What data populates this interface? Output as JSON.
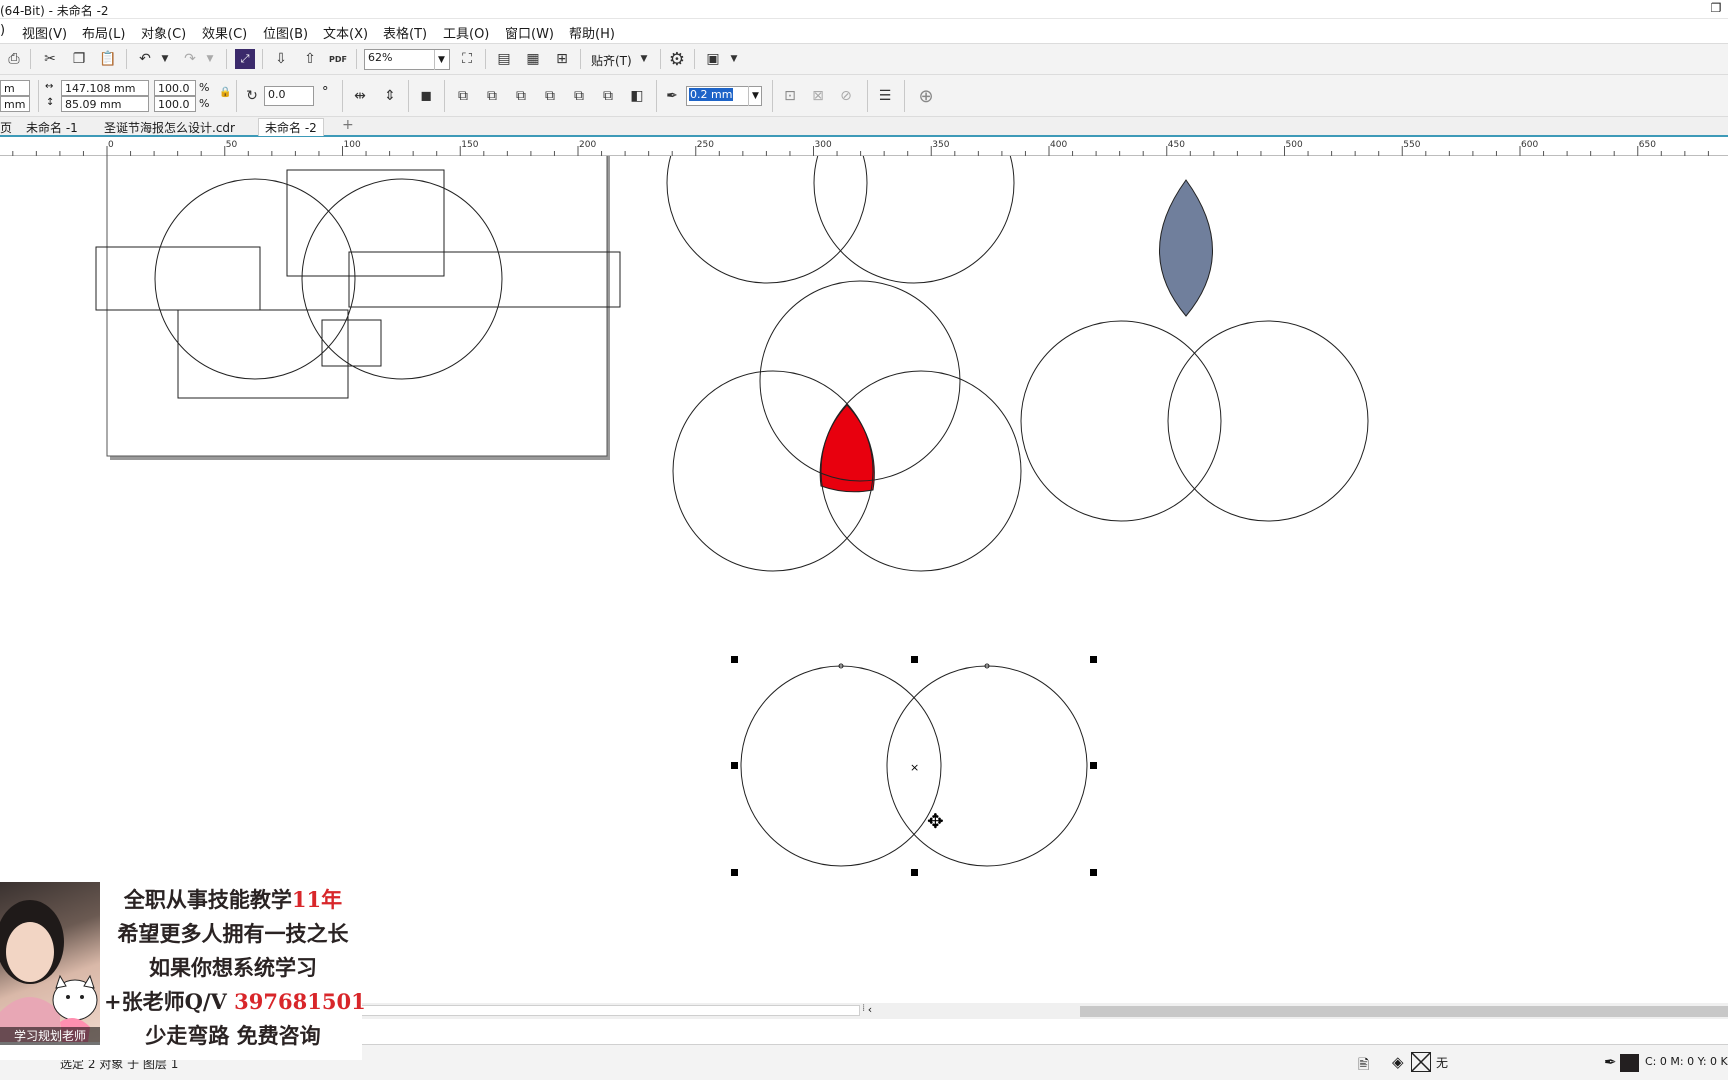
{
  "window": {
    "title": "(64-Bit) - 未命名 -2",
    "restore_glyph": "❐"
  },
  "menu": [
    "视图(V)",
    "布局(L)",
    "对象(C)",
    "效果(C)",
    "位图(B)",
    "文本(X)",
    "表格(T)",
    "工具(O)",
    "窗口(W)",
    "帮助(H)"
  ],
  "toolbar": {
    "zoom_value": "62%",
    "snap_label": "贴齐(T)",
    "pdf_label": "PDF"
  },
  "property_bar": {
    "pos_x_partial": "m",
    "pos_y_partial": "mm",
    "width_value": "147.108 mm",
    "height_value": "85.09 mm",
    "scale_x": "100.0",
    "scale_y": "100.0",
    "percent_symbol": "%",
    "rotation_value": "0.0",
    "degree_symbol": "°",
    "outline_width": "0.2 mm"
  },
  "tabs": [
    "未命名 -1",
    "圣诞节海报怎么设计.cdr",
    "未命名 -2"
  ],
  "tab_left_partial": "页",
  "active_tab_index": 2,
  "ruler": {
    "labels": [
      "0",
      "50",
      "100",
      "150",
      "200",
      "250",
      "300",
      "350",
      "400",
      "450",
      "500",
      "550",
      "600",
      "650"
    ]
  },
  "status": {
    "left_text": "选定 2 对象 于 图层 1",
    "fill_label": "无",
    "color_readout": "C: 0 M: 0 Y: 0 K:"
  },
  "promo": {
    "lines": [
      {
        "text": "全职从事技能教学",
        "red": "11年"
      },
      {
        "text": "希望更多人拥有一技之长",
        "red": ""
      },
      {
        "text": "如果你想系统学习",
        "red": ""
      },
      {
        "text": "+张老师Q/V ",
        "red": "397681501"
      },
      {
        "text": "少走弯路 免费咨询",
        "red": ""
      }
    ],
    "caption": "学习规划老师"
  },
  "colors": {
    "red_fill": "#e8000e",
    "gray_fill": "#707f9c",
    "tab_accent": "#3d9ab8"
  }
}
